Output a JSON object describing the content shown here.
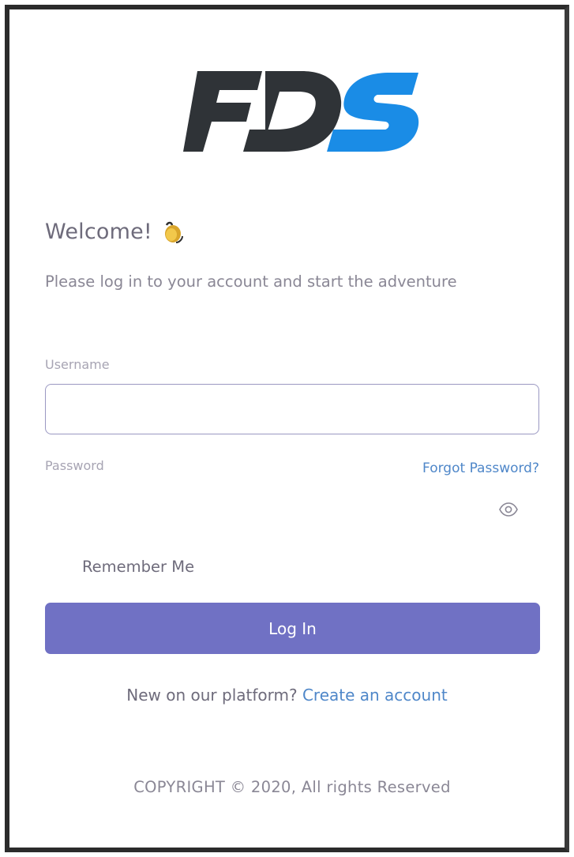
{
  "brand": {
    "logo_text": "FDS",
    "logo_dark_color": "#2f3337",
    "logo_accent_color": "#1a8ce6"
  },
  "header": {
    "welcome": "Welcome!",
    "wave_icon": "waving-hand-icon",
    "subtitle": "Please log in to your account and start the adventure"
  },
  "form": {
    "username_label": "Username",
    "username_value": "",
    "password_label": "Password",
    "password_value": "",
    "forgot_password": "Forgot Password?",
    "show_password_icon": "eye-icon",
    "remember_me": "Remember Me",
    "remember_checked": false,
    "login_button": "Log In"
  },
  "signup": {
    "prompt": "New on our platform?",
    "link": "Create an account"
  },
  "footer": {
    "copyright": "COPYRIGHT © 2020, All rights Reserved"
  },
  "colors": {
    "primary": "#7071c4",
    "link": "#4f87c9",
    "text": "#6e6b7b",
    "muted": "#a7a4b3"
  }
}
